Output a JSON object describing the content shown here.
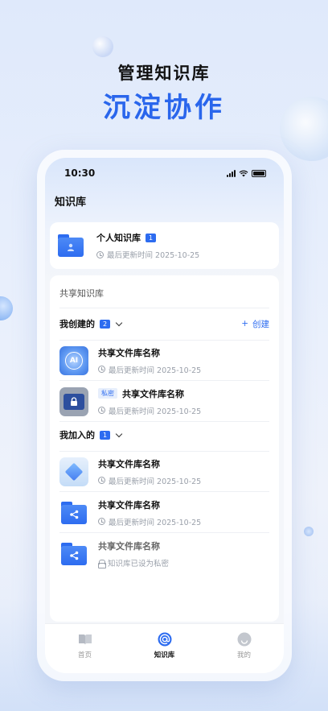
{
  "headline": {
    "line1": "管理知识库",
    "line2": "沉淀协作"
  },
  "status_bar": {
    "time": "10:30"
  },
  "page": {
    "title": "知识库"
  },
  "personal": {
    "name": "个人知识库",
    "count": "1",
    "meta": "最后更新时间  2025-10-25"
  },
  "shared": {
    "title": "共享知识库",
    "created": {
      "label": "我创建的",
      "count": "2",
      "create_label": "创建",
      "items": [
        {
          "name": "共享文件库名称",
          "meta": "最后更新时间  2025-10-25",
          "tag": ""
        },
        {
          "name": "共享文件库名称",
          "meta": "最后更新时间  2025-10-25",
          "tag": "私密"
        }
      ]
    },
    "joined": {
      "label": "我加入的",
      "count": "1",
      "items": [
        {
          "name": "共享文件库名称",
          "meta": "最后更新时间  2025-10-25"
        },
        {
          "name": "共享文件库名称",
          "meta": "最后更新时间  2025-10-25"
        },
        {
          "name": "共享文件库名称",
          "meta": "知识库已设为私密"
        }
      ]
    }
  },
  "tabbar": {
    "items": [
      {
        "label": "首页",
        "icon": "book-icon"
      },
      {
        "label": "知识库",
        "icon": "at-icon"
      },
      {
        "label": "我的",
        "icon": "smile-icon"
      }
    ]
  },
  "thumb_ai_text": "AI",
  "colors": {
    "accent": "#2d6cf0",
    "headline_blue": "#2a66ec"
  }
}
